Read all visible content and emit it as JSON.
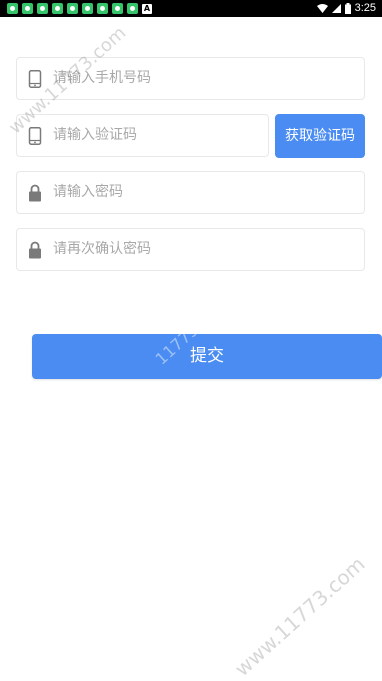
{
  "status_bar": {
    "time": "3:25",
    "notification_icon": "A"
  },
  "form": {
    "phone_placeholder": "请输入手机号码",
    "code_placeholder": "请输入验证码",
    "get_code_label": "获取验证码",
    "password_placeholder": "请输入密码",
    "confirm_password_placeholder": "请再次确认密码",
    "submit_label": "提交"
  },
  "watermark": {
    "text": "www.11773.com",
    "partial": "11773"
  },
  "colors": {
    "accent": "#4a8cf1",
    "placeholder": "#a8a8a8",
    "border": "#e8e8e8"
  },
  "icons": {
    "phone": "phone-icon",
    "lock": "lock-icon",
    "wifi": "wifi-icon",
    "signal": "signal-icon",
    "battery": "battery-icon"
  }
}
